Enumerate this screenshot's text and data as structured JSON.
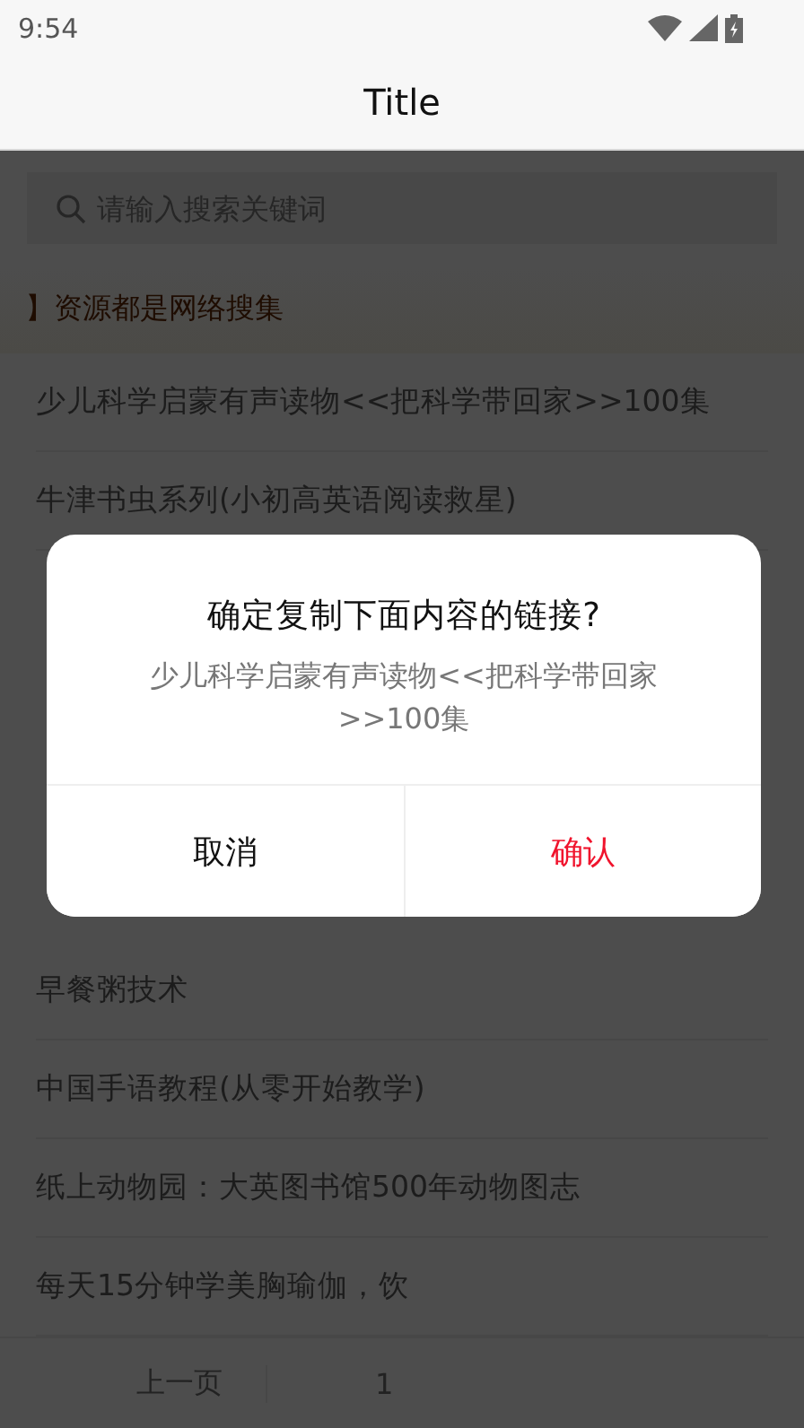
{
  "status_bar": {
    "time": "9:54"
  },
  "app_bar": {
    "title": "Title"
  },
  "search": {
    "placeholder": "请输入搜索关键词"
  },
  "notice": {
    "text": "】资源都是网络搜集"
  },
  "list": [
    {
      "title": "少儿科学启蒙有声读物<<把科学带回家>>100集"
    },
    {
      "title": "牛津书虫系列(小初高英语阅读救星)"
    },
    {
      "title": "早餐粥技术"
    },
    {
      "title": "中国手语教程(从零开始教学)"
    },
    {
      "title": "纸上动物园：大英图书馆500年动物图志"
    },
    {
      "title": "每天15分钟学美胸瑜伽，饮"
    }
  ],
  "pager": {
    "prev": "上一页",
    "page": "1"
  },
  "dialog": {
    "title": "确定复制下面内容的链接?",
    "message": "少儿科学启蒙有声读物<<把科学带回家>>100集",
    "buttons": [
      {
        "label": "取消",
        "kind": "cancel"
      },
      {
        "label": "确认",
        "kind": "confirm"
      }
    ]
  }
}
